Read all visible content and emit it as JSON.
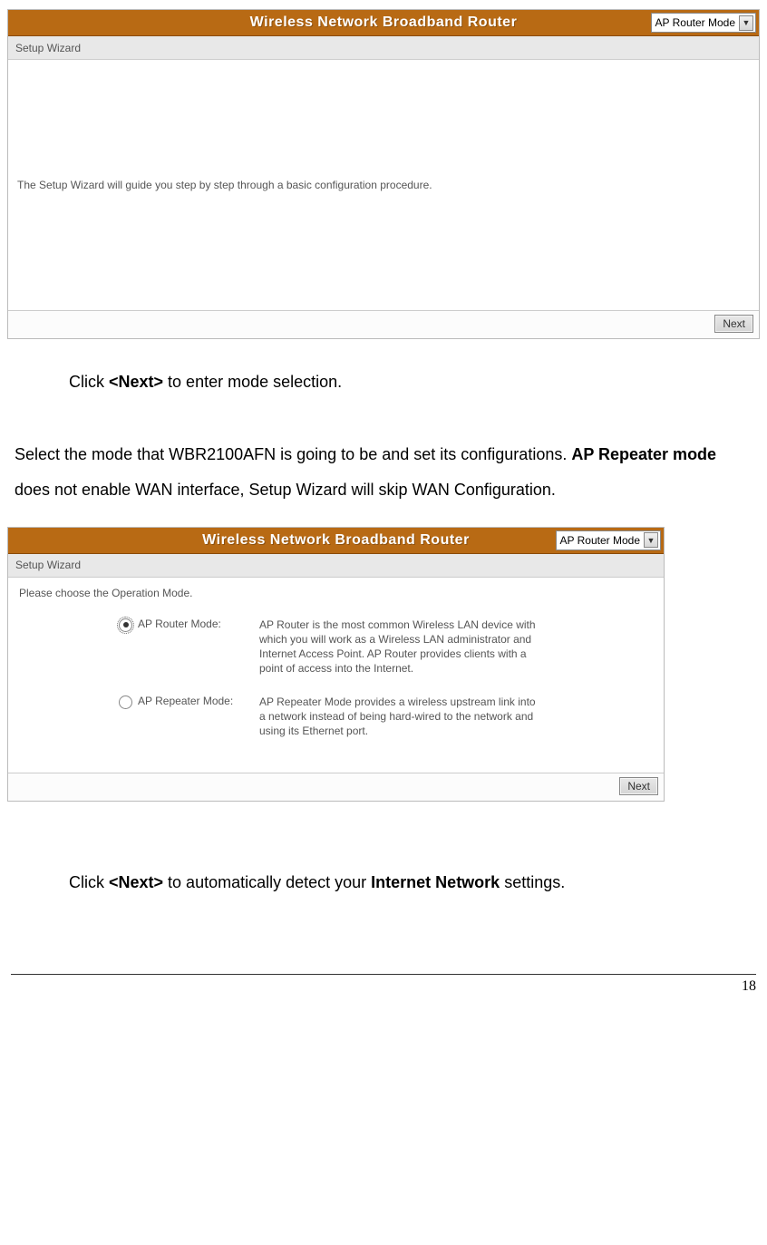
{
  "header_title": "Wireless Network Broadband Router",
  "mode_selected": "AP Router Mode",
  "wizard_subtitle": "Setup Wizard",
  "wizard1_description": "The Setup Wizard will guide you step by step through a basic configuration procedure.",
  "next_label": "Next",
  "instr1_pre": "Click ",
  "instr1_bold": "<Next>",
  "instr1_post": " to enter mode selection.",
  "para2_pre": "Select the mode that WBR2100AFN is going to be and set its configurations. ",
  "para2_bold": "AP Repeater mode",
  "para2_post": " does not enable WAN interface, Setup Wizard will skip WAN Configuration.",
  "choose_text": "Please choose the Operation Mode.",
  "options": [
    {
      "label": "AP Router Mode:",
      "checked": true,
      "desc": "AP Router is the most common Wireless LAN device with which you will work as a Wireless LAN administrator and Internet Access Point. AP Router provides clients with a point of access into the Internet."
    },
    {
      "label": "AP Repeater Mode:",
      "checked": false,
      "desc": "AP Repeater Mode provides a wireless upstream link into a network instead of being hard-wired to the network and using its Ethernet port."
    }
  ],
  "instr2_pre": "Click ",
  "instr2_bold1": "<Next>",
  "instr2_mid": " to automatically detect your ",
  "instr2_bold2": "Internet Network",
  "instr2_post": " settings.",
  "page_number": "18"
}
